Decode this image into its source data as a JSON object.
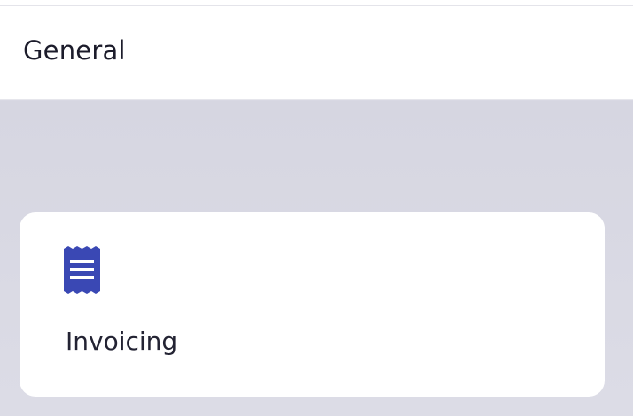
{
  "header": {
    "title": "General"
  },
  "cards": [
    {
      "label": "Invoicing",
      "icon": "receipt-icon",
      "icon_color": "#3a48b4"
    }
  ],
  "colors": {
    "background": "#d8d8e3",
    "surface": "#ffffff",
    "text": "#1c1c2b",
    "accent": "#3a48b4"
  }
}
